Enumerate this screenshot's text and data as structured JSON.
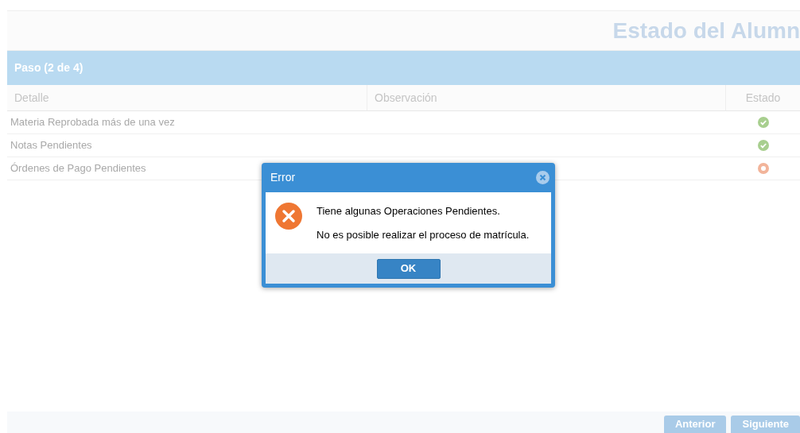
{
  "page": {
    "title": "Estado del Alumn"
  },
  "step": {
    "title": "Paso (2 de 4)"
  },
  "table": {
    "columns": [
      "Detalle",
      "Observación",
      "Estado"
    ],
    "rows": [
      {
        "detalle": "Materia Reprobada más de una vez",
        "kind": "ok"
      },
      {
        "detalle": "Notas Pendientes",
        "kind": "ok"
      },
      {
        "detalle": "Órdenes de Pago Pendientes",
        "kind": "error"
      }
    ]
  },
  "dialog": {
    "title": "Error",
    "lines": [
      "Tiene algunas Operaciones Pendientes.",
      "No es posible realizar el proceso de matrícula."
    ],
    "button": "OK"
  },
  "nav_buttons": [
    "Anterior",
    "Siguiente"
  ]
}
